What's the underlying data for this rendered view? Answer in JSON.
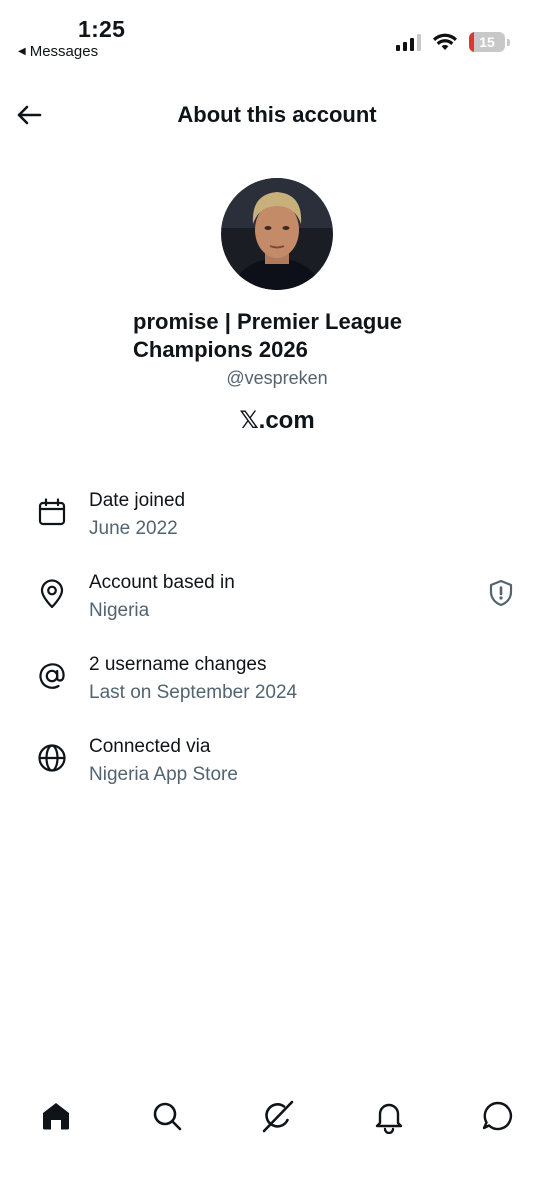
{
  "status_bar": {
    "time": "1:25",
    "back_app": "Messages",
    "battery_level": "15",
    "battery_color": "#e0352b"
  },
  "header": {
    "title": "About this account",
    "back_icon": "arrow-left-icon"
  },
  "profile": {
    "display_name": "promise | Premier League Champions 2026",
    "handle": "@vespreken",
    "site": "𝕏.com"
  },
  "info": [
    {
      "icon": "calendar-icon",
      "label": "Date joined",
      "value": "June 2022"
    },
    {
      "icon": "location-pin-icon",
      "label": "Account based in",
      "value": "Nigeria"
    },
    {
      "icon": "at-sign-icon",
      "label": "2 username changes",
      "value": "Last on September 2024"
    },
    {
      "icon": "globe-icon",
      "label": "Connected via",
      "value": "Nigeria App Store"
    }
  ],
  "tabs": [
    "home-icon",
    "search-icon",
    "grok-icon",
    "notifications-icon",
    "messages-icon"
  ],
  "colors": {
    "text": "#0f1419",
    "secondary": "#536471"
  }
}
